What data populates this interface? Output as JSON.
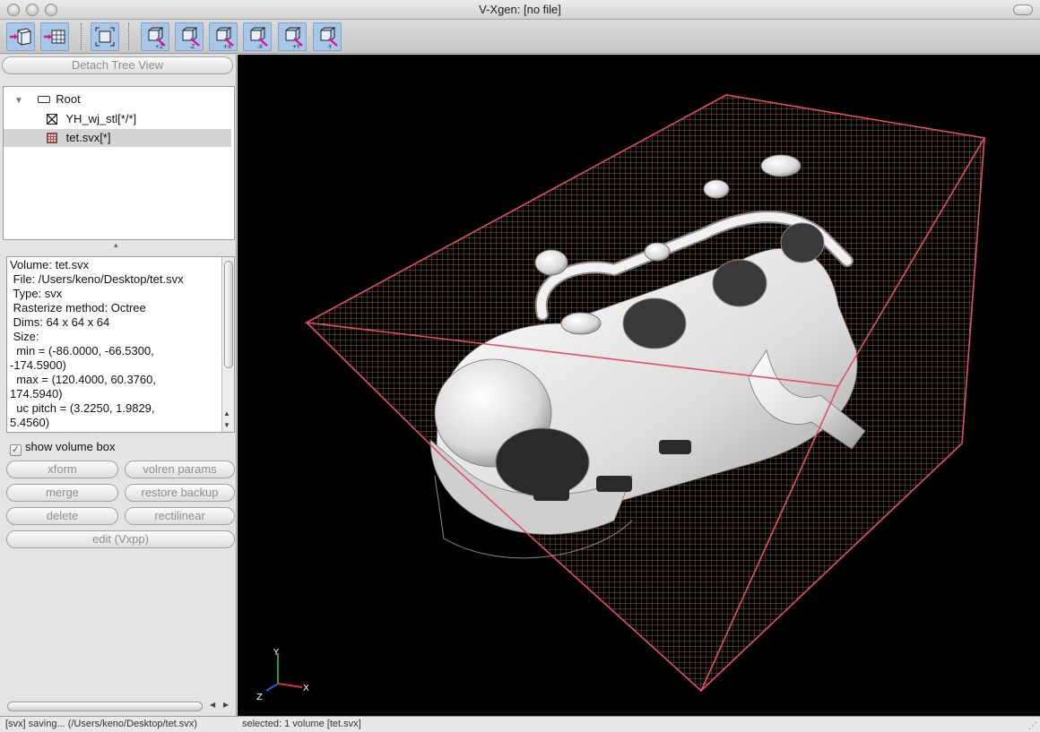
{
  "window": {
    "title": "V-Xgen: [no file]"
  },
  "toolbar": {
    "buttons": [
      {
        "icon": "import-volume-icon"
      },
      {
        "icon": "import-mesh-icon"
      },
      {
        "icon": "fit-view-icon"
      },
      {
        "icon": "view-plus-z-icon",
        "label": "+Z"
      },
      {
        "icon": "view-minus-z-icon",
        "label": "-Z"
      },
      {
        "icon": "view-plus-x-icon",
        "label": "+X"
      },
      {
        "icon": "view-minus-x-icon",
        "label": "-X"
      },
      {
        "icon": "view-plus-y-icon",
        "label": "+Y"
      },
      {
        "icon": "view-minus-y-icon",
        "label": "-Y"
      }
    ]
  },
  "left_panel": {
    "detach_label": "Detach Tree View",
    "tree": {
      "root_label": "Root",
      "items": [
        {
          "label": "YH_wj_stl[*/*]",
          "icon": "mesh-icon",
          "selected": false
        },
        {
          "label": "tet.svx[*]",
          "icon": "volume-icon",
          "selected": true
        }
      ]
    },
    "info_lines": [
      "Volume: tet.svx",
      " File: /Users/keno/Desktop/tet.svx",
      " Type: svx",
      " Rasterize method: Octree",
      " Dims: 64 x 64 x 64",
      " Size:",
      "  min = (-86.0000, -66.5300,",
      "-174.5900)",
      "  max = (120.4000, 60.3760,",
      "174.5940)",
      "  uc pitch = (3.2250, 1.9829,",
      "5.4560)"
    ],
    "show_volume_box_label": "show volume box",
    "buttons": {
      "xform": "xform",
      "volren_params": "volren params",
      "merge": "merge",
      "restore_backup": "restore backup",
      "delete": "delete",
      "rectilinear": "rectilinear",
      "edit": "edit (Vxpp)"
    }
  },
  "viewport": {
    "axis_labels": {
      "x": "X",
      "y": "Y",
      "z": "Z"
    },
    "colors": {
      "box_edge": "#e0506a",
      "grid": "#c88a1e",
      "background": "#000000",
      "model": "#e8e8e8"
    }
  },
  "status": {
    "left": "[svx] saving... (/Users/keno/Desktop/tet.svx)",
    "right": "selected: 1 volume [tet.svx]"
  }
}
